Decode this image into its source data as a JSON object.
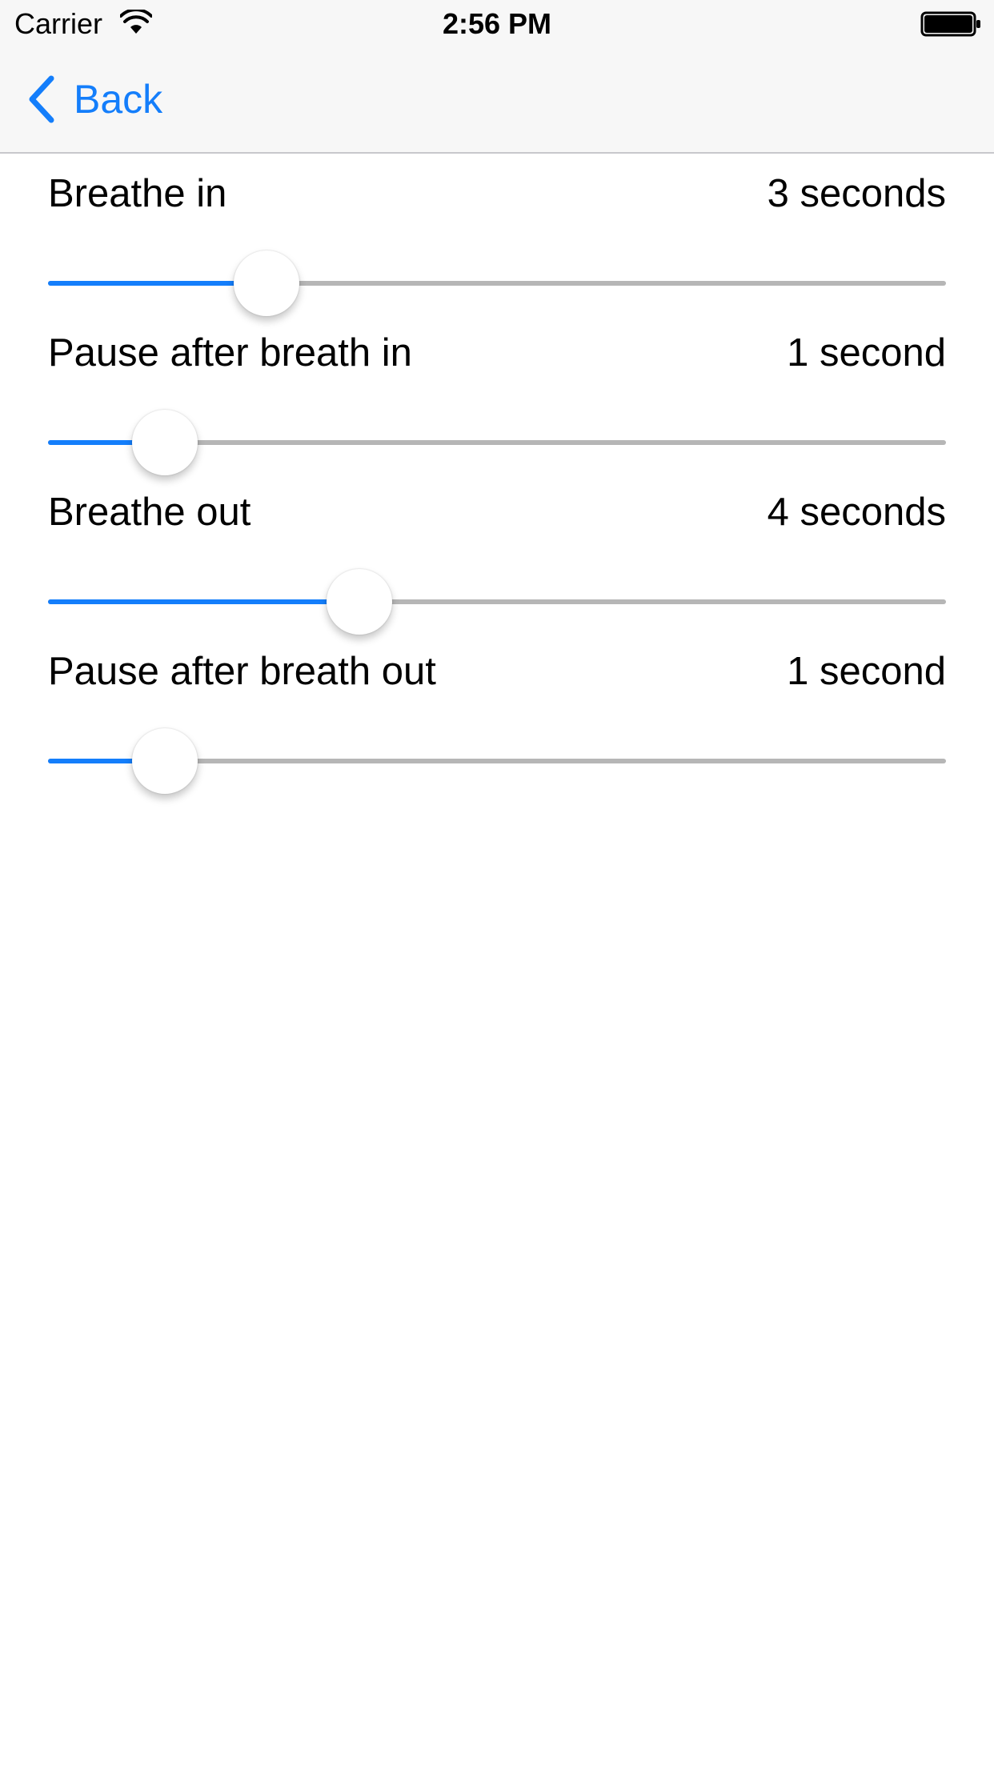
{
  "status_bar": {
    "carrier": "Carrier",
    "time": "2:56 PM"
  },
  "nav": {
    "back_label": "Back"
  },
  "colors": {
    "accent": "#147efb",
    "track": "#b6b6b6",
    "nav_background": "#f7f7f7"
  },
  "settings": [
    {
      "label": "Breathe in",
      "value_text": "3 seconds",
      "slider_fraction": 0.243
    },
    {
      "label": "Pause after breath in",
      "value_text": "1 second",
      "slider_fraction": 0.13
    },
    {
      "label": "Breathe out",
      "value_text": "4 seconds",
      "slider_fraction": 0.347
    },
    {
      "label": "Pause after breath out",
      "value_text": "1 second",
      "slider_fraction": 0.13
    }
  ]
}
